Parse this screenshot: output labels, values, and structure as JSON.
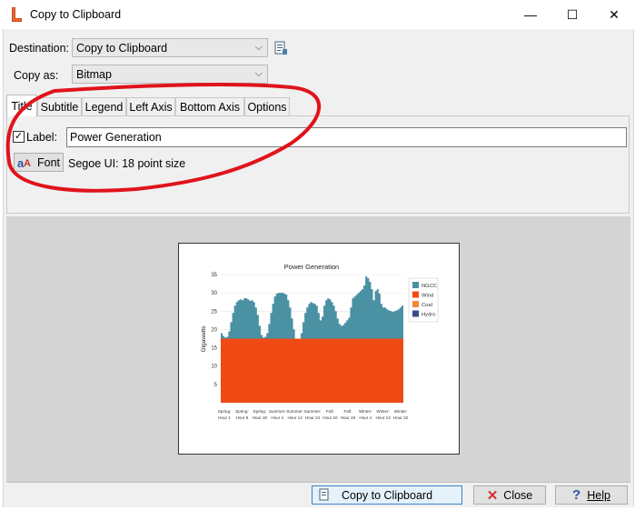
{
  "window": {
    "title": "Copy to Clipboard",
    "minimize_glyph": "—",
    "maximize_glyph": "☐",
    "close_glyph": "✕"
  },
  "destination": {
    "label": "Destination:",
    "value": "Copy to Clipboard"
  },
  "copy_as": {
    "label": "Copy as:",
    "value": "Bitmap"
  },
  "tabs": [
    {
      "label": "Title",
      "active": true
    },
    {
      "label": "Subtitle"
    },
    {
      "label": "Legend"
    },
    {
      "label": "Left Axis"
    },
    {
      "label": "Bottom Axis"
    },
    {
      "label": "Options"
    }
  ],
  "title_tab": {
    "label_checkbox": "Label:",
    "checked": true,
    "label_value": "Power Generation",
    "font_button": "Font",
    "font_desc": "Segoe UI: 18 point size"
  },
  "buttons": {
    "copy": "Copy to Clipboard",
    "close": "Close",
    "help": "Help"
  },
  "annotation_color": "#e0131b",
  "chart_data": {
    "type": "area",
    "title": "Power Generation",
    "ylabel": "Gigawatts",
    "xlabel": "",
    "ylim": [
      0,
      35
    ],
    "yticks": [
      5,
      10,
      15,
      20,
      25,
      30,
      35
    ],
    "categories": [
      [
        "Spring:",
        "Hour 1"
      ],
      [
        "Spring:",
        "Hour 9"
      ],
      [
        "Spring:",
        "Hour 18"
      ],
      [
        "Summer:",
        "Hour 4"
      ],
      [
        "Summer:",
        "Hour 14"
      ],
      [
        "Summer:",
        "Hour 24"
      ],
      [
        "Fall:",
        "Hour 10"
      ],
      [
        "Fall:",
        "Hour 19"
      ],
      [
        "Winter:",
        "Hour 4"
      ],
      [
        "Winter:",
        "Hour 13"
      ],
      [
        "Winter:",
        "Hour 22"
      ]
    ],
    "legend": [
      {
        "name": "NGCC",
        "color": "#4a91a3"
      },
      {
        "name": "Wind",
        "color": "#f04a14"
      },
      {
        "name": "Coal",
        "color": "#f08a3a"
      },
      {
        "name": "Hydro",
        "color": "#3a4a8a"
      }
    ],
    "series": [
      {
        "name": "Wind",
        "color": "#f04a14",
        "values": [
          17.5,
          17.5,
          17.5,
          17.5,
          17.5,
          17.5,
          17.5,
          17.5,
          17.5,
          17.5,
          17.5,
          17.5,
          17.5,
          17.5,
          17.5,
          17.5,
          17.5,
          17.5,
          17.5,
          17.5,
          17.5,
          17.5,
          17.5,
          17.5,
          17.5,
          17.5,
          17.5,
          17.5,
          17.5,
          17.5,
          17.5,
          17.5,
          17.5,
          17.5,
          17.5,
          17.5,
          17.5,
          17.5,
          17.5,
          17.5,
          17.5,
          17.5,
          17.5,
          17.5,
          17.5,
          17.5,
          17.5,
          17.5,
          17.5,
          17.5,
          17.5,
          17.5,
          17.5,
          17.5,
          17.5,
          17.5,
          17.5,
          17.5,
          17.5,
          17.5,
          17.5,
          17.5,
          17.5,
          17.5,
          17.5,
          17.5,
          17.5,
          17.5,
          17.5,
          17.5,
          17.5,
          17.5,
          17.5,
          17.5,
          17.5,
          17.5,
          17.5,
          17.5,
          17.5,
          17.5,
          17.5,
          17.5,
          17.5,
          17.5,
          17.5,
          17.5,
          17.5,
          17.5,
          17.5,
          17.5,
          17.5,
          17.5,
          17.5,
          17.5,
          17.5,
          17.5
        ]
      },
      {
        "name": "NGCC",
        "color": "#4a91a3",
        "values": [
          19,
          18.2,
          17.8,
          18,
          19.5,
          22,
          24.5,
          26.5,
          27.5,
          28,
          28.2,
          28,
          28.5,
          28.5,
          28.2,
          27.8,
          28,
          27.5,
          26,
          24,
          21,
          18.5,
          17.8,
          18,
          19,
          21.5,
          24.5,
          27,
          29,
          29.8,
          30,
          30,
          30,
          29.8,
          29.5,
          28,
          26,
          23,
          20,
          17.5,
          17,
          17.5,
          19,
          22,
          24.5,
          26,
          27,
          27.5,
          27.2,
          27,
          26.5,
          24.5,
          22.5,
          23.5,
          26.5,
          28,
          28.5,
          28.2,
          27.5,
          26.5,
          25,
          23,
          21.5,
          21,
          21.2,
          21.8,
          22.5,
          23.2,
          26,
          28.5,
          29,
          29.5,
          30,
          30.5,
          31,
          32,
          34.5,
          34,
          33,
          31,
          28,
          30.5,
          31,
          29.8,
          27,
          26,
          26,
          25.5,
          25.2,
          25,
          24.8,
          25,
          25.2,
          25.5,
          26,
          26.5
        ]
      },
      {
        "name": "Coal",
        "color": "#f08a3a",
        "values": []
      },
      {
        "name": "Hydro",
        "color": "#3a4a8a",
        "values": []
      }
    ]
  }
}
